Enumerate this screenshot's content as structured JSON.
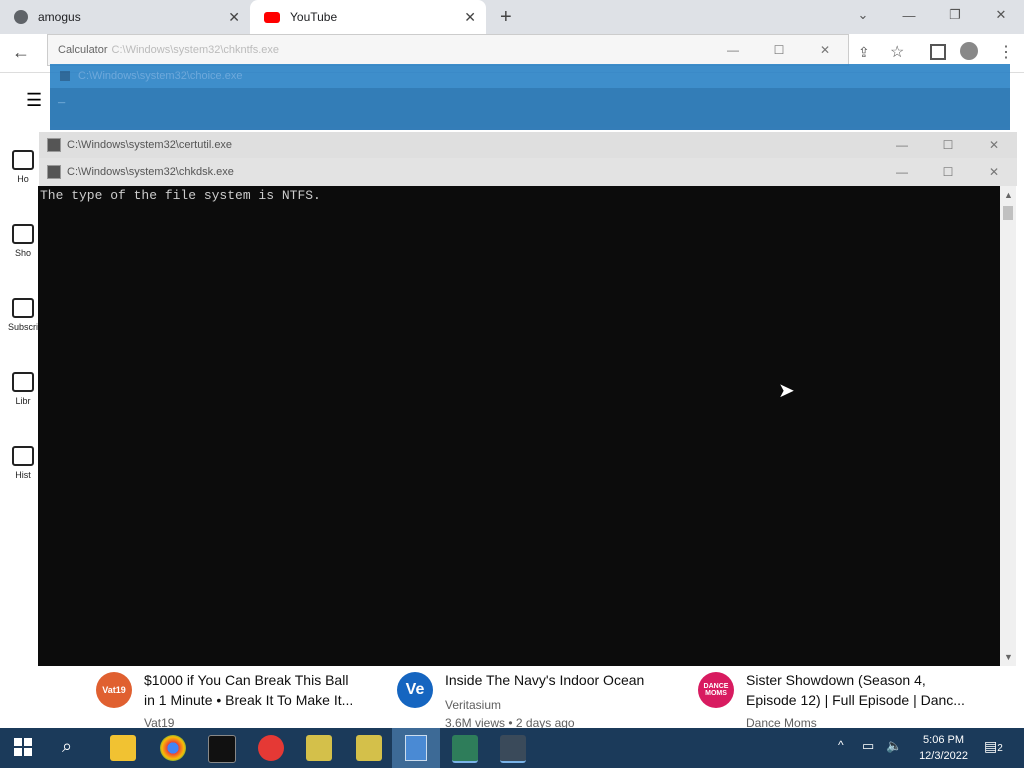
{
  "browser": {
    "tabs": [
      {
        "label": "amogus",
        "active": false
      },
      {
        "label": "YouTube",
        "active": true
      }
    ],
    "new_tab": "+"
  },
  "youtube_sidebar": {
    "items": [
      {
        "label": "Ho",
        "icon": "home-icon"
      },
      {
        "label": "Sho",
        "icon": "shorts-icon"
      },
      {
        "label": "Subscri",
        "icon": "subscriptions-icon"
      },
      {
        "label": "Libr",
        "icon": "library-icon"
      },
      {
        "label": "Hist",
        "icon": "history-icon"
      }
    ]
  },
  "windows": {
    "calculator": {
      "title": "Calculator",
      "behind_title": "C:\\Windows\\system32\\chkntfs.exe"
    },
    "choice": {
      "title": "C:\\Windows\\system32\\choice.exe",
      "cursor": "_"
    },
    "certutil": {
      "title": "C:\\Windows\\system32\\certutil.exe"
    },
    "chkdsk": {
      "title": "C:\\Windows\\system32\\chkdsk.exe"
    }
  },
  "console": {
    "output": "The type of the file system is NTFS."
  },
  "videos": [
    {
      "title_line1": "$1000 if You Can Break This Ball",
      "title_line2": "in 1 Minute • Break It To Make It...",
      "channel": "Vat19",
      "views": "",
      "avatar": "Vat19",
      "avatar_color": "#e06030"
    },
    {
      "title_line1": "Inside The Navy's Indoor Ocean",
      "title_line2": "",
      "channel": "Veritasium",
      "views": "3.6M views • 2 days ago",
      "avatar": "Ve",
      "avatar_color": "#1565c0"
    },
    {
      "title_line1": "Sister Showdown (Season 4,",
      "title_line2": "Episode 12) | Full Episode | Danc...",
      "channel": "Dance Moms",
      "views": "",
      "avatar": "DANCE MOMS",
      "avatar_color": "#d81b60"
    }
  ],
  "taskbar": {
    "time": "5:06 PM",
    "date": "12/3/2022",
    "notifications": "2",
    "accent": "#1b3a5a"
  }
}
